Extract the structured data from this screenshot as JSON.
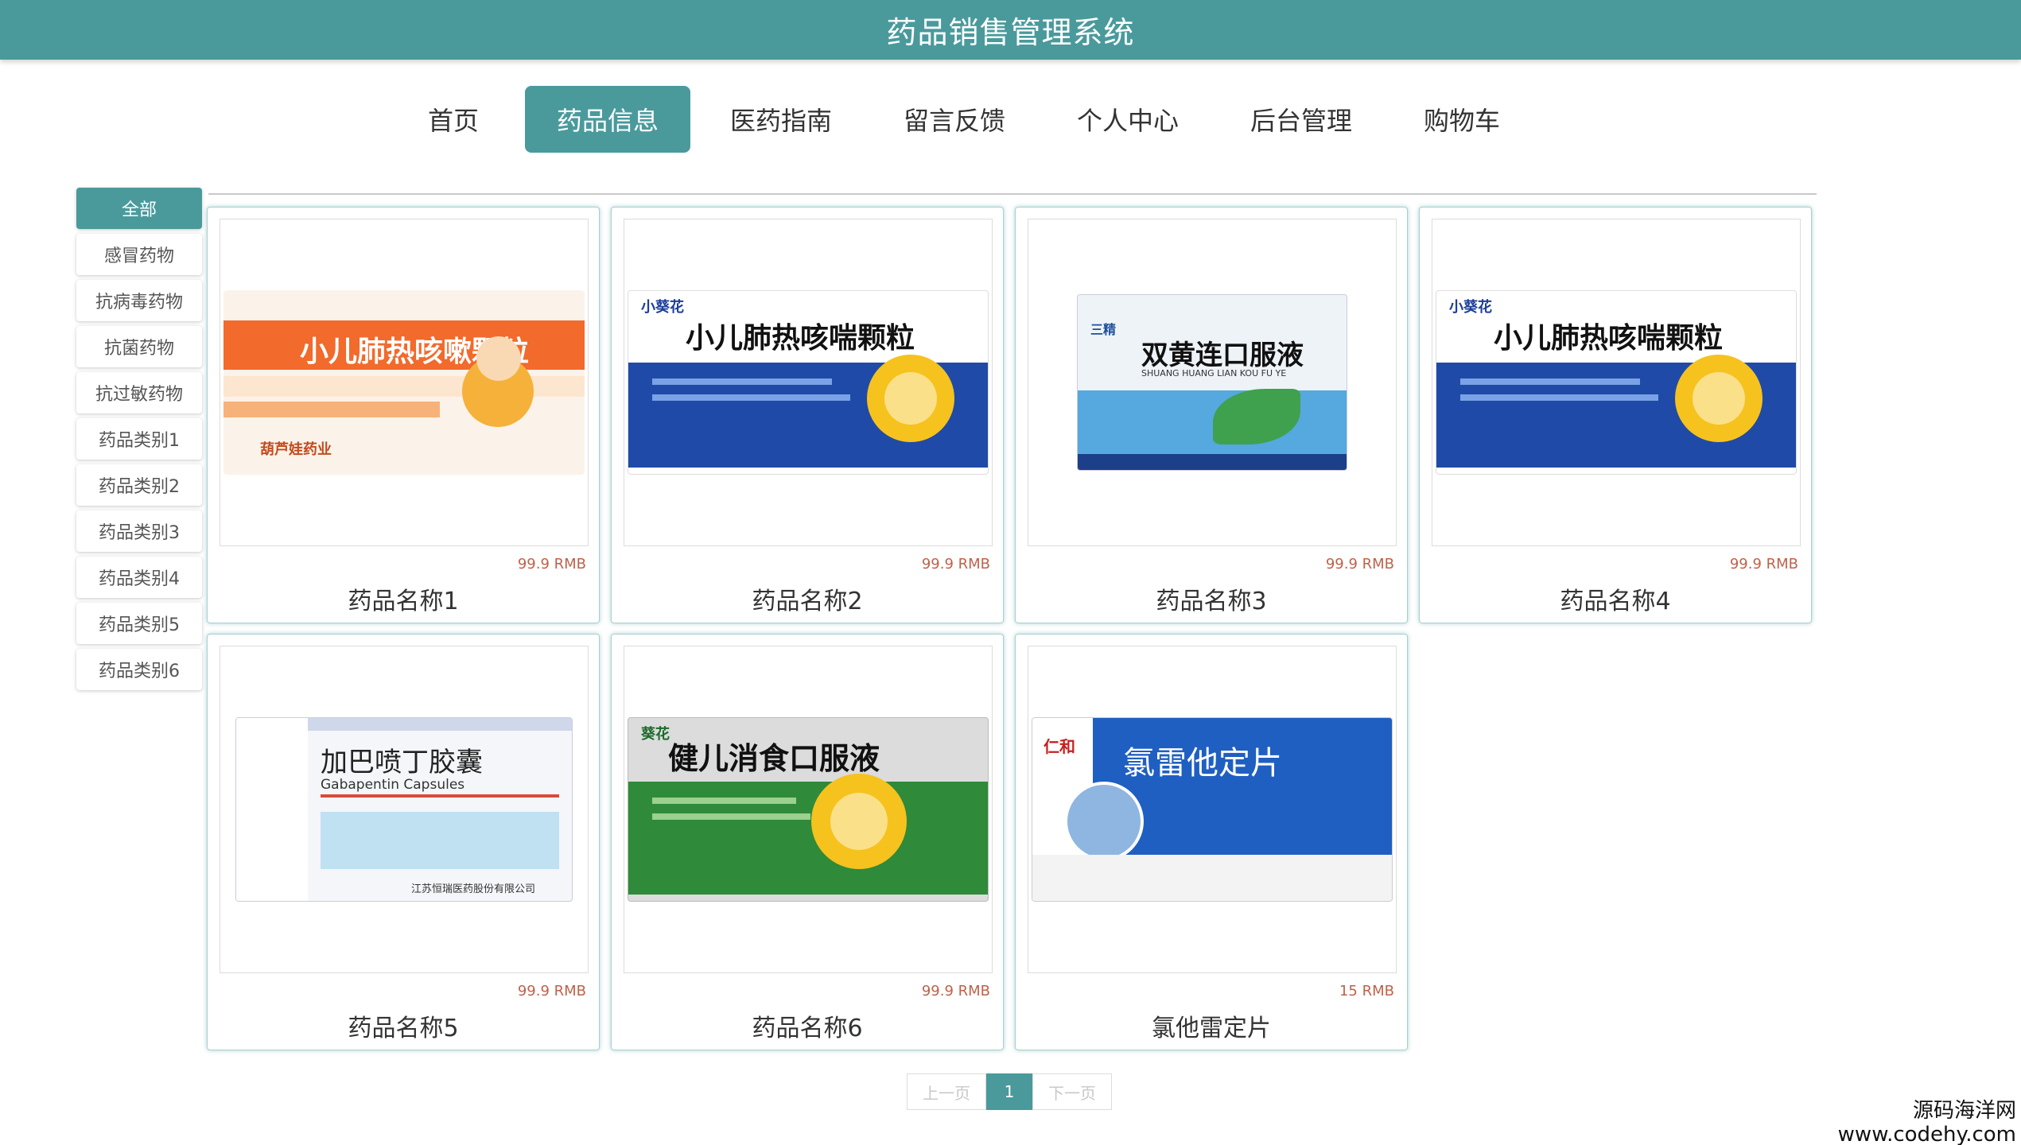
{
  "header": {
    "title": "药品销售管理系统"
  },
  "nav": {
    "items": [
      "首页",
      "药品信息",
      "医药指南",
      "留言反馈",
      "个人中心",
      "后台管理",
      "购物车"
    ],
    "active_index": 1
  },
  "sidebar": {
    "items": [
      "全部",
      "感冒药物",
      "抗病毒药物",
      "抗菌药物",
      "抗过敏药物",
      "药品类别1",
      "药品类别2",
      "药品类别3",
      "药品类别4",
      "药品类别5",
      "药品类别6"
    ],
    "active_index": 0
  },
  "products": [
    {
      "name": "药品名称1",
      "price": "99.9 RMB",
      "package": {
        "title": "小儿肺热咳嗽颗粒",
        "maker": "葫芦娃药业",
        "theme": "orange"
      }
    },
    {
      "name": "药品名称2",
      "price": "99.9 RMB",
      "package": {
        "title": "小儿肺热咳喘颗粒",
        "maker": "小葵花",
        "theme": "blue"
      }
    },
    {
      "name": "药品名称3",
      "price": "99.9 RMB",
      "package": {
        "title": "双黄连口服液",
        "subtitle": "SHUANG HUANG LIAN KOU FU YE",
        "maker": "三精",
        "theme": "lightblue"
      }
    },
    {
      "name": "药品名称4",
      "price": "99.9 RMB",
      "package": {
        "title": "小儿肺热咳喘颗粒",
        "maker": "小葵花",
        "theme": "blue"
      }
    },
    {
      "name": "药品名称5",
      "price": "99.9 RMB",
      "package": {
        "title": "加巴喷丁胶囊",
        "subtitle": "Gabapentin Capsules",
        "maker": "江苏恒瑞医药股份有限公司",
        "theme": "pale"
      }
    },
    {
      "name": "药品名称6",
      "price": "99.9 RMB",
      "package": {
        "title": "健儿消食口服液",
        "maker": "葵花",
        "theme": "green"
      }
    },
    {
      "name": "氯他雷定片",
      "price": "15 RMB",
      "package": {
        "title": "氯雷他定片",
        "maker": "仁和",
        "theme": "deepblue"
      }
    }
  ],
  "pagination": {
    "prev": "上一页",
    "current": "1",
    "next": "下一页"
  },
  "watermark": {
    "line1": "源码海洋网",
    "line2": "www.codehy.com"
  },
  "colors": {
    "primary": "#4a9a9c",
    "price": "#c0614a"
  }
}
